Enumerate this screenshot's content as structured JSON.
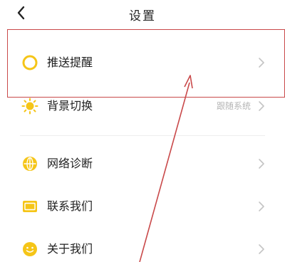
{
  "header": {
    "title": "设置"
  },
  "settings": {
    "items": [
      {
        "label": "推送提醒",
        "icon": "circle-ring-icon",
        "value": ""
      },
      {
        "label": "背景切换",
        "icon": "sun-icon",
        "value": "跟随系统"
      },
      {
        "label": "网络诊断",
        "icon": "globe-icon",
        "value": ""
      },
      {
        "label": "联系我们",
        "icon": "mail-icon",
        "value": ""
      },
      {
        "label": "关于我们",
        "icon": "smile-icon",
        "value": ""
      }
    ]
  },
  "colors": {
    "accent": "#f5c518",
    "annotation": "#c9494a",
    "chevron": "#c4c4c4",
    "text": "#222222",
    "muted": "#b5b5b5"
  }
}
